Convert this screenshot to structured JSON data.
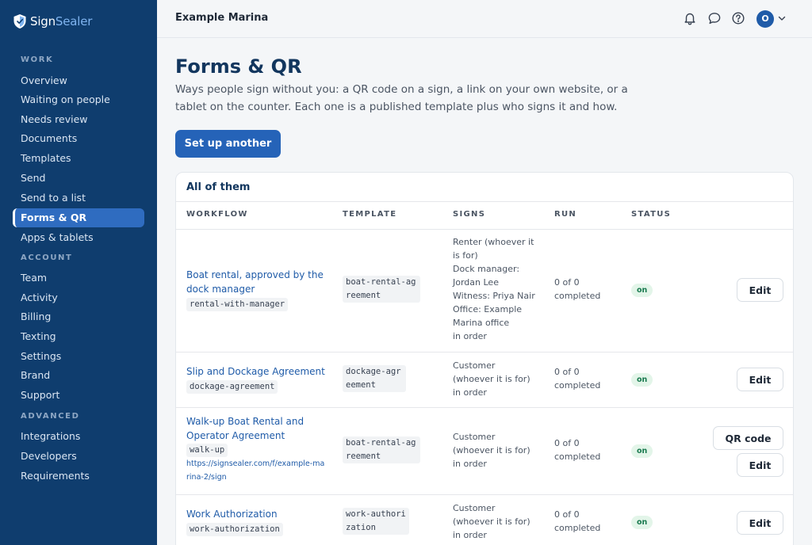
{
  "brand": {
    "name_part1": "Sign",
    "name_part2": "Sealer"
  },
  "sidebar": {
    "sections": [
      {
        "label": "WORK",
        "items": [
          "Overview",
          "Waiting on people",
          "Needs review",
          "Documents",
          "Templates",
          "Send",
          "Send to a list",
          "Forms & QR",
          "Apps & tablets"
        ]
      },
      {
        "label": "ACCOUNT",
        "items": [
          "Team",
          "Activity",
          "Billing",
          "Texting",
          "Settings",
          "Brand",
          "Support"
        ]
      },
      {
        "label": "ADVANCED",
        "items": [
          "Integrations",
          "Developers",
          "Requirements"
        ]
      }
    ],
    "active_item": "Forms & QR"
  },
  "topbar": {
    "org_name": "Example Marina",
    "avatar_initial": "O"
  },
  "page": {
    "title": "Forms & QR",
    "description": "Ways people sign without you: a QR code on a sign, a link on your own website, or a tablet on the counter. Each one is a published template plus who signs it and how.",
    "primary_button": "Set up another"
  },
  "table": {
    "card_title": "All of them",
    "headers": {
      "workflow": "WORKFLOW",
      "template": "TEMPLATE",
      "signs": "SIGNS",
      "run": "RUN",
      "status": "STATUS"
    },
    "rows": [
      {
        "name": "Boat rental, approved by the dock manager",
        "slug": "rental-with-manager",
        "url": "",
        "template": "boat-rental-agreement",
        "signs": "Renter (whoever it is for)\nDock manager: Jordan Lee\nWitness: Priya Nair\nOffice: Example Marina office\nin order",
        "run": "0 of 0 completed",
        "status": "on",
        "qr_label": "",
        "edit_label": "Edit"
      },
      {
        "name": "Slip and Dockage Agreement",
        "slug": "dockage-agreement",
        "url": "",
        "template": "dockage-agreement",
        "signs": "Customer\n(whoever it is for)\nin order",
        "run": "0 of 0 completed",
        "status": "on",
        "qr_label": "",
        "edit_label": "Edit"
      },
      {
        "name": "Walk-up Boat Rental and Operator Agreement",
        "slug": "walk-up",
        "url": "https://signsealer.com/f/example-marina-2/sign",
        "template": "boat-rental-agreement",
        "signs": "Customer\n(whoever it is for)\nin order",
        "run": "0 of 0 completed",
        "status": "on",
        "qr_label": "QR code",
        "edit_label": "Edit"
      },
      {
        "name": "Work Authorization",
        "slug": "work-authorization",
        "url": "",
        "template": "work-authorization",
        "signs": "Customer\n(whoever it is for)\nin order",
        "run": "0 of 0 completed",
        "status": "on",
        "qr_label": "",
        "edit_label": "Edit"
      }
    ]
  },
  "icons": {
    "notifications": "bell-icon",
    "messages": "chat-bubble-icon",
    "help": "help-circle-icon",
    "menu": "chevron-down-icon",
    "logo": "shield-icon"
  },
  "colors": {
    "sidebar": "#0f3d6e",
    "accent": "#2563b8",
    "active_nav": "#2f6cc0",
    "status_on_bg": "#e3f5e9",
    "status_on_text": "#18794e"
  }
}
